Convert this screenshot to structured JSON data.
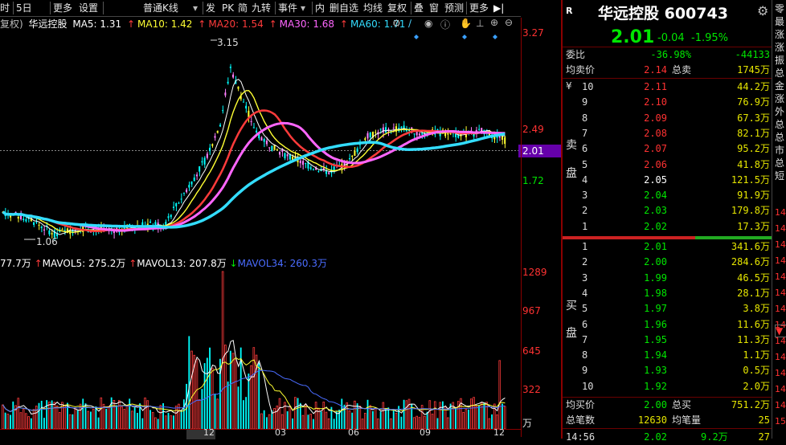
{
  "toolbar": {
    "items": [
      "时",
      "5日",
      "更多",
      "设置",
      "普通K线",
      "发",
      "PK",
      "简",
      "九转",
      "事件",
      "内",
      "删自选",
      "均线",
      "复权",
      "叠",
      "窗",
      "预测",
      "更多"
    ],
    "dropdown_arrow": "chevron-down-icon",
    "collapse_icon": "collapse-right-icon"
  },
  "ma_legend": {
    "prefix": "复权)",
    "name": "华远控股",
    "ma5": "MA5: 1.31",
    "ma10": "MA10: 1.42",
    "ma20": "MA20: 1.54",
    "ma30": "MA30: 1.68",
    "ma60": "MA60: 1.71",
    "colors": {
      "ma5": "#ffffff",
      "ma10": "#ffff33",
      "ma20": "#ff3b3b",
      "ma30": "#ff66ff",
      "ma60": "#33ddff"
    }
  },
  "price_axis": {
    "labels": [
      "3.27",
      "2.49",
      "2.01",
      "1.72"
    ],
    "current_price": "2.01",
    "high_marker": "3.15",
    "low_marker": "1.06"
  },
  "volume_legend": {
    "vol": "77.7万",
    "mavol5": "MAVOL5: 275.2万",
    "mavol13": "MAVOL13: 207.8万",
    "mavol34": "MAVOL34: 260.3万"
  },
  "volume_axis": {
    "labels": [
      "1289",
      "967",
      "645",
      "322"
    ],
    "unit": "万"
  },
  "time_axis": {
    "labels": [
      "12",
      "03",
      "06",
      "09",
      "12"
    ]
  },
  "header": {
    "badge": "R",
    "title": "华远控股 600743",
    "settings_icon": "gear-icon",
    "price": "2.01",
    "change": "-0.04",
    "change_pct": "-1.95%"
  },
  "stats": {
    "weibi_label": "委比",
    "weibi_value": "-36.98%",
    "weicha_value": "-44133",
    "avg_sell_label": "均卖价",
    "avg_sell_value": "2.14",
    "total_sell_label": "总卖",
    "total_sell_value": "1745万",
    "avg_buy_label": "均买价",
    "avg_buy_value": "2.00",
    "total_buy_label": "总买",
    "total_buy_value": "751.2万",
    "total_trades_label": "总笔数",
    "total_trades_value": "12630",
    "avg_trade_label": "均笔量",
    "avg_trade_value": "25",
    "last_time": "14:56",
    "last_price": "2.02",
    "last_vol": "9.2万",
    "last_n": "27"
  },
  "sell_side": {
    "label_top": "卖",
    "label_bottom": "盘",
    "yen": "¥",
    "levels": [
      {
        "level": "10",
        "price": "2.11",
        "volume": "44.2万",
        "color": "red"
      },
      {
        "level": "9",
        "price": "2.10",
        "volume": "76.9万",
        "color": "red"
      },
      {
        "level": "8",
        "price": "2.09",
        "volume": "67.3万",
        "color": "red"
      },
      {
        "level": "7",
        "price": "2.08",
        "volume": "82.1万",
        "color": "red"
      },
      {
        "level": "6",
        "price": "2.07",
        "volume": "95.2万",
        "color": "red"
      },
      {
        "level": "5",
        "price": "2.06",
        "volume": "41.8万",
        "color": "red"
      },
      {
        "level": "4",
        "price": "2.05",
        "volume": "121.5万",
        "color": "white"
      },
      {
        "level": "3",
        "price": "2.04",
        "volume": "91.9万",
        "color": "green"
      },
      {
        "level": "2",
        "price": "2.03",
        "volume": "179.8万",
        "color": "green"
      },
      {
        "level": "1",
        "price": "2.02",
        "volume": "17.3万",
        "color": "green"
      }
    ]
  },
  "buy_side": {
    "label_top": "买",
    "label_bottom": "盘",
    "levels": [
      {
        "level": "1",
        "price": "2.01",
        "volume": "341.6万",
        "color": "green"
      },
      {
        "level": "2",
        "price": "2.00",
        "volume": "284.6万",
        "color": "green"
      },
      {
        "level": "3",
        "price": "1.99",
        "volume": "46.5万",
        "color": "green"
      },
      {
        "level": "4",
        "price": "1.98",
        "volume": "28.1万",
        "color": "green"
      },
      {
        "level": "5",
        "price": "1.97",
        "volume": "3.8万",
        "color": "green"
      },
      {
        "level": "6",
        "price": "1.96",
        "volume": "11.6万",
        "color": "green"
      },
      {
        "level": "7",
        "price": "1.95",
        "volume": "11.3万",
        "color": "green"
      },
      {
        "level": "8",
        "price": "1.94",
        "volume": "1.1万",
        "color": "green"
      },
      {
        "level": "9",
        "price": "1.93",
        "volume": "0.5万",
        "color": "green"
      },
      {
        "level": "10",
        "price": "1.92",
        "volume": "2.0万",
        "color": "green"
      }
    ]
  },
  "edge_column": {
    "chars": [
      "零",
      "最",
      "涨",
      "涨",
      "振",
      "总",
      "金",
      "涨",
      "外",
      "总",
      "总",
      "市",
      "总",
      "短"
    ],
    "nums": [
      "14",
      "14",
      "14",
      "14",
      "14",
      "14",
      "14",
      "14",
      "14",
      "14",
      "14",
      "14",
      "14",
      "15"
    ],
    "scroll_icon": "scroll-down-arrow-icon"
  }
}
